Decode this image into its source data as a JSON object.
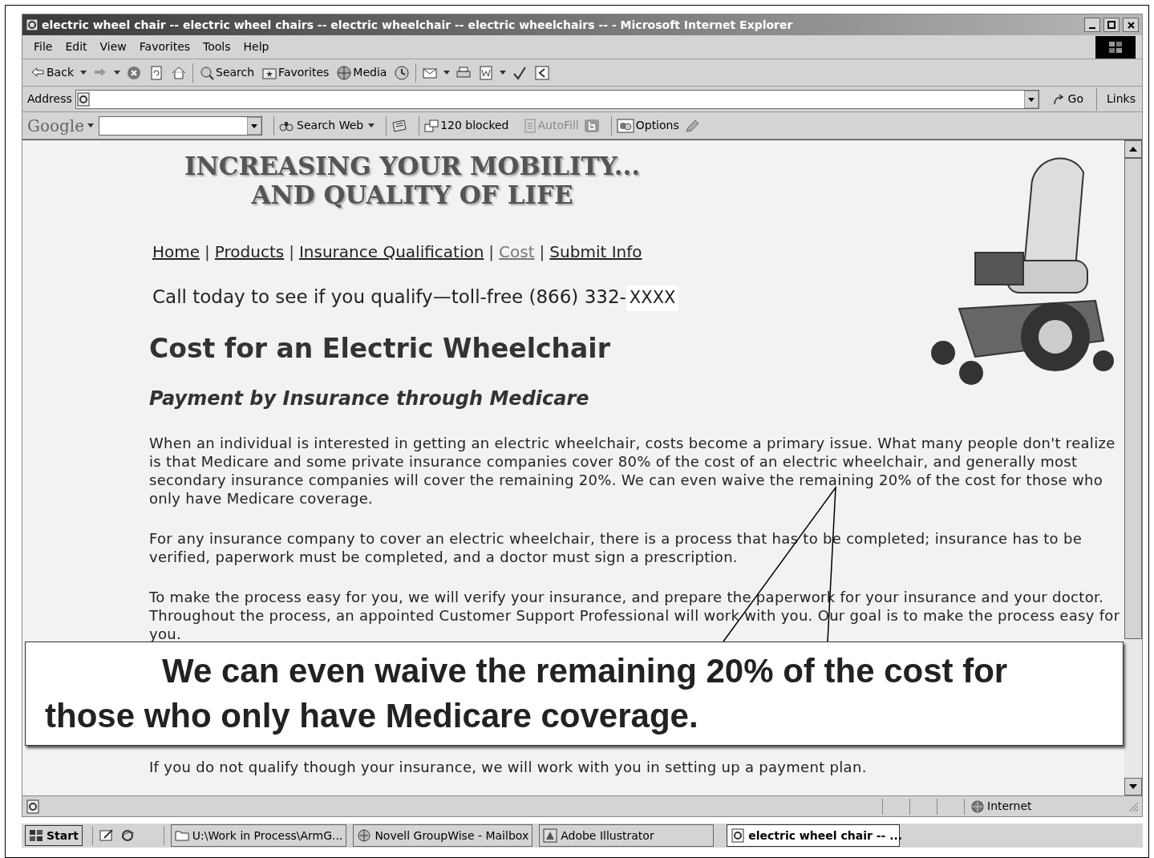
{
  "window": {
    "title": "electric wheel chair -- electric wheel chairs -- electric wheelchair -- electric wheelchairs -- - Microsoft Internet Explorer"
  },
  "menu": [
    "File",
    "Edit",
    "View",
    "Favorites",
    "Tools",
    "Help"
  ],
  "toolbar": [
    {
      "kind": "back",
      "label": "Back",
      "dropdown": true
    },
    {
      "kind": "forward",
      "dropdown": true
    },
    {
      "kind": "stop"
    },
    {
      "kind": "refresh"
    },
    {
      "kind": "home"
    },
    {
      "kind": "search",
      "label": "Search"
    },
    {
      "kind": "favorites",
      "label": "Favorites"
    },
    {
      "kind": "media",
      "label": "Media"
    },
    {
      "kind": "history"
    },
    {
      "kind": "mail",
      "dropdown": true
    },
    {
      "kind": "print"
    },
    {
      "kind": "edit",
      "dropdown": true
    },
    {
      "kind": "spell"
    },
    {
      "kind": "discuss"
    }
  ],
  "address_bar": {
    "label": "Address",
    "go": "Go",
    "links": "Links"
  },
  "google_toolbar": {
    "logo": "Google",
    "search_web": "Search Web",
    "blocked": "120 blocked",
    "autofill": "AutoFill",
    "options": "Options"
  },
  "page": {
    "banner": [
      "INCREASING YOUR MOBILITY...",
      "AND QUALITY OF LIFE"
    ],
    "nav": [
      {
        "kind": "link",
        "label": "Home",
        "selected": false
      },
      {
        "kind": "separator",
        "label": "|"
      },
      {
        "kind": "link",
        "label": "Products",
        "selected": false
      },
      {
        "kind": "separator",
        "label": "|"
      },
      {
        "kind": "link",
        "label": "Insurance Qualification",
        "selected": false
      },
      {
        "kind": "separator",
        "label": "|"
      },
      {
        "kind": "link",
        "label": "Cost",
        "selected": true
      },
      {
        "kind": "separator",
        "label": "|"
      },
      {
        "kind": "link",
        "label": "Submit Info",
        "selected": false
      }
    ],
    "phone": "Call today to see if you qualify—toll-free (866) 332-",
    "phone_suffix": "XXXX",
    "heading": "Cost for an Electric Wheelchair",
    "subheading": "Payment by Insurance through Medicare",
    "paragraphs": [
      "When an individual is interested in getting an electric wheelchair, costs become a primary issue. What many people don't realize is that Medicare and some private insurance companies cover 80% of the cost of an electric wheelchair, and generally most secondary insurance companies will cover the remaining 20%. We can even waive the remaining 20% of the cost for those who only have Medicare coverage.",
      "For any insurance company to cover an electric wheelchair, there is a process that has to be completed; insurance has to be verified, paperwork must be completed, and a doctor must sign a prescription.",
      "To make the process easy for you, we will verify your insurance, and prepare the paperwork for your insurance and your doctor. Throughout the process, an appointed Customer Support Professional will work with you. Our goal is to make the process easy for you.",
      "If you do not qualify though your insurance, we will work with you in setting up a payment plan."
    ]
  },
  "callout": "We can even waive the remaining 20% of the cost for those who only have Medicare coverage.",
  "status_bar": {
    "zone": "Internet"
  },
  "taskbar": {
    "start": "Start",
    "tasks": [
      {
        "label": "U:\\Work in Process\\ArmG...",
        "kind": "folder",
        "selected": false
      },
      {
        "label": "Novell GroupWise - Mailbox",
        "kind": "groupwise",
        "selected": false
      },
      {
        "label": "Adobe Illustrator",
        "kind": "illustrator",
        "selected": false
      },
      {
        "label": "electric wheel chair -- ...",
        "kind": "browser",
        "selected": true
      }
    ]
  }
}
